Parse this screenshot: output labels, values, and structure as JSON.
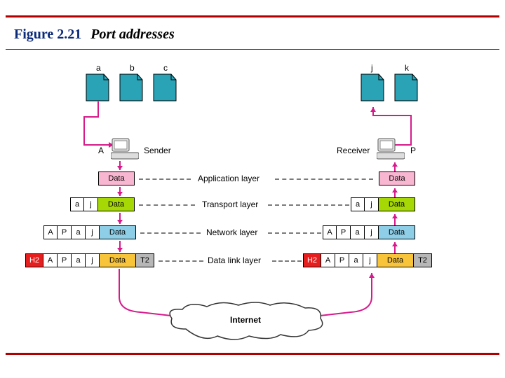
{
  "title": {
    "figure": "Figure 2.21",
    "subject": "Port addresses"
  },
  "processes": {
    "sender": [
      {
        "id": "a"
      },
      {
        "id": "b"
      },
      {
        "id": "c"
      }
    ],
    "receiver": [
      {
        "id": "j"
      },
      {
        "id": "k"
      }
    ]
  },
  "hosts": {
    "sender": {
      "letter": "A",
      "role": "Sender"
    },
    "receiver": {
      "letter": "P",
      "role": "Receiver"
    }
  },
  "layers": {
    "app": {
      "name": "Application layer",
      "sender": {
        "data": "Data"
      },
      "receiver": {
        "data": "Data"
      }
    },
    "trans": {
      "name": "Transport layer",
      "sender": {
        "src": "a",
        "dst": "j",
        "data": "Data"
      },
      "receiver": {
        "src": "a",
        "dst": "j",
        "data": "Data"
      }
    },
    "net": {
      "name": "Network layer",
      "sender": {
        "src_ip": "A",
        "dst_ip": "P",
        "src": "a",
        "dst": "j",
        "data": "Data"
      },
      "receiver": {
        "src_ip": "A",
        "dst_ip": "P",
        "src": "a",
        "dst": "j",
        "data": "Data"
      }
    },
    "link": {
      "name": "Data link layer",
      "sender": {
        "head": "H2",
        "src_ip": "A",
        "dst_ip": "P",
        "src": "a",
        "dst": "j",
        "data": "Data",
        "tail": "T2"
      },
      "receiver": {
        "head": "H2",
        "src_ip": "A",
        "dst_ip": "P",
        "src": "a",
        "dst": "j",
        "data": "Data",
        "tail": "T2"
      }
    }
  },
  "internet": "Internet",
  "colors": {
    "rule": "#b00000",
    "doc_fill": "#2aa3b7",
    "arrow": "#d61a8c"
  },
  "chart_data": {
    "type": "diagram",
    "title": "Port addresses",
    "sender_processes": [
      "a",
      "b",
      "c"
    ],
    "receiver_processes": [
      "j",
      "k"
    ],
    "sender_host": {
      "ip": "A",
      "role": "Sender"
    },
    "receiver_host": {
      "ip": "P",
      "role": "Receiver"
    },
    "encapsulation": [
      {
        "layer": "Application layer",
        "pdu": [
          "Data"
        ]
      },
      {
        "layer": "Transport layer",
        "pdu": [
          "a",
          "j",
          "Data"
        ]
      },
      {
        "layer": "Network layer",
        "pdu": [
          "A",
          "P",
          "a",
          "j",
          "Data"
        ]
      },
      {
        "layer": "Data link layer",
        "pdu": [
          "H2",
          "A",
          "P",
          "a",
          "j",
          "Data",
          "T2"
        ]
      }
    ],
    "link": "Internet"
  }
}
